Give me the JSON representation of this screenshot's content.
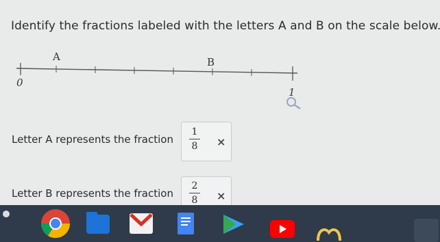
{
  "question": {
    "prompt": "Identify the fractions labeled with the letters A and B on the scale below."
  },
  "number_line": {
    "label_A": "A",
    "label_B": "B",
    "label_0": "0",
    "label_1": "1"
  },
  "answers": [
    {
      "label": "Letter A represents the fraction",
      "numerator": "1",
      "denominator": "8",
      "mark": "×"
    },
    {
      "label": "Letter B represents the fraction",
      "numerator": "2",
      "denominator": "8",
      "mark": "×"
    }
  ],
  "dock": {
    "icons": [
      "chrome-icon",
      "files-icon",
      "gmail-icon",
      "docs-icon",
      "play-store-icon",
      "youtube-icon",
      "app-icon"
    ]
  }
}
